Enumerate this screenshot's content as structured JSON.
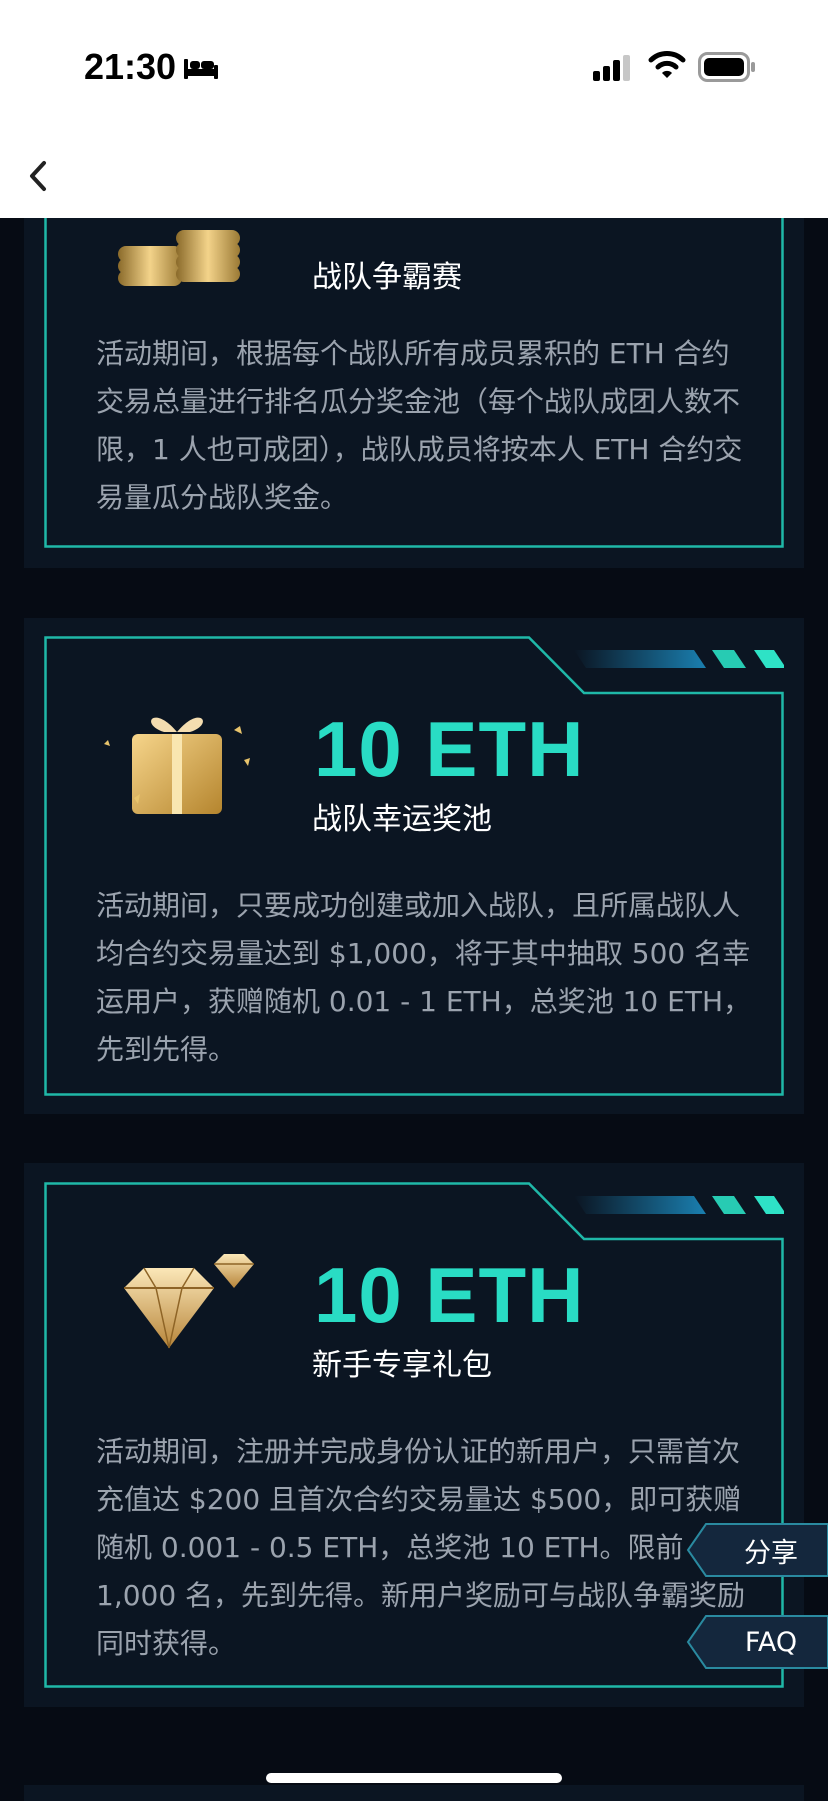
{
  "status_bar": {
    "time": "21:30",
    "icons": [
      "bed-icon",
      "signal-icon",
      "wifi-icon",
      "battery-icon"
    ]
  },
  "nav": {
    "back_icon": "chevron-left-icon"
  },
  "cards": [
    {
      "amount": "",
      "title": "战队争霸赛",
      "description": "活动期间，根据每个战队所有成员累积的 ETH 合约交易总量进行排名瓜分奖金池（每个战队成团人数不限，1 人也可成团），战队成员将按本人 ETH 合约交易量瓜分战队奖金。",
      "illustration": "gold-coins-icon"
    },
    {
      "amount": "10 ETH",
      "title": "战队幸运奖池",
      "description": "活动期间，只要成功创建或加入战队，且所属战队人均合约交易量达到 $1,000，将于其中抽取 500 名幸运用户，获赠随机 0.01 - 1 ETH，总奖池 10 ETH，先到先得。",
      "illustration": "gift-box-icon"
    },
    {
      "amount": "10 ETH",
      "title": "新手专享礼包",
      "description": "活动期间，注册并完成身份认证的新用户，只需首次充值达 $200 且首次合约交易量达 $500，即可获赠随机 0.001 - 0.5 ETH，总奖池 10 ETH。限前 1,000 名，先到先得。新用户奖励可与战队争霸奖励同时获得。",
      "illustration": "diamond-icon"
    }
  ],
  "floating": {
    "share_label": "分享",
    "faq_label": "FAQ"
  },
  "colors": {
    "accent": "#29dcc4",
    "background": "#060b14",
    "card": "#0b1522",
    "text_muted": "#9ba3ae"
  }
}
